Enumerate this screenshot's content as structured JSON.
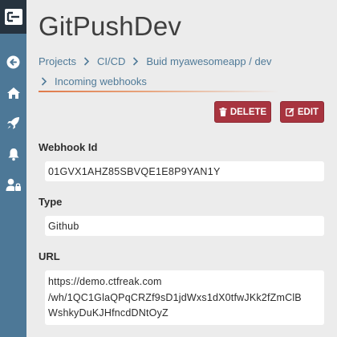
{
  "app": {
    "title": "GitPushDev"
  },
  "sidebar": {
    "items": [
      {
        "icon": "back-arrow-icon"
      },
      {
        "icon": "home-icon"
      },
      {
        "icon": "rocket-icon"
      },
      {
        "icon": "bell-icon"
      },
      {
        "icon": "user-lock-icon"
      }
    ]
  },
  "breadcrumb": {
    "items": [
      "Projects",
      "CI/CD",
      "Buid myawesomeapp / dev",
      "Incoming webhooks"
    ]
  },
  "actions": {
    "delete_label": "DELETE",
    "edit_label": "EDIT"
  },
  "webhook": {
    "id_label": "Webhook Id",
    "id_value": "01GVX1AHZ85SBVQE1E8P9YAN1Y",
    "type_label": "Type",
    "type_value": "Github",
    "url_label": "URL",
    "url_lines": [
      "https://demo.ctfreak.com",
      "/wh/1QC1GlaQPqCRZf9sD1jdWxs1dX0tfwJKk2fZmClB",
      "WshkyDuKJHfncdDNtOyZ"
    ]
  },
  "colors": {
    "sidebar": "#4d7897",
    "logo_bg": "#26333f",
    "accent": "#4f7a98",
    "button": "#a8343f",
    "divider": "#e07a4a"
  }
}
